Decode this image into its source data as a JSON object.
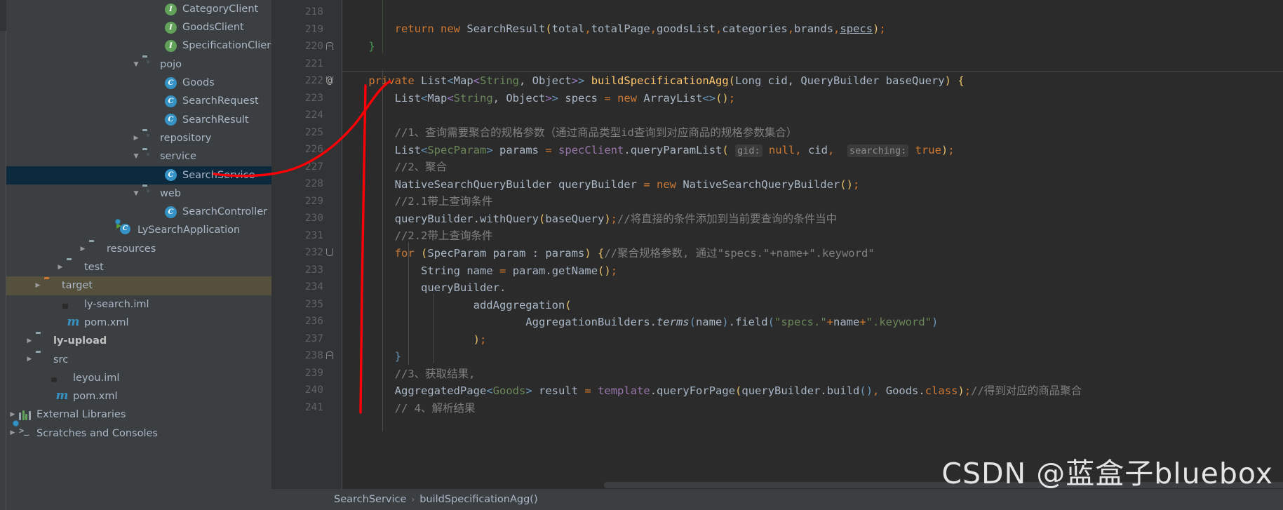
{
  "sidebar": {
    "items": [
      {
        "indent": 208,
        "arrow": "none",
        "icon": "interface-icon",
        "label": "CategoryClient",
        "bold": false,
        "state": "normal"
      },
      {
        "indent": 208,
        "arrow": "none",
        "icon": "interface-icon",
        "label": "GoodsClient",
        "bold": false,
        "state": "normal"
      },
      {
        "indent": 208,
        "arrow": "none",
        "icon": "interface-icon",
        "label": "SpecificationClier",
        "bold": false,
        "state": "normal"
      },
      {
        "indent": 176,
        "arrow": "down",
        "icon": "folder-icon",
        "label": "pojo",
        "bold": false,
        "state": "normal"
      },
      {
        "indent": 208,
        "arrow": "none",
        "icon": "class-icon",
        "label": "Goods",
        "bold": false,
        "state": "normal"
      },
      {
        "indent": 208,
        "arrow": "none",
        "icon": "class-icon",
        "label": "SearchRequest",
        "bold": false,
        "state": "normal"
      },
      {
        "indent": 208,
        "arrow": "none",
        "icon": "class-icon",
        "label": "SearchResult",
        "bold": false,
        "state": "normal"
      },
      {
        "indent": 176,
        "arrow": "right",
        "icon": "folder-icon",
        "label": "repository",
        "bold": false,
        "state": "normal"
      },
      {
        "indent": 176,
        "arrow": "down",
        "icon": "folder-icon",
        "label": "service",
        "bold": false,
        "state": "normal"
      },
      {
        "indent": 208,
        "arrow": "none",
        "icon": "class-icon",
        "label": "SearchService",
        "bold": false,
        "state": "selected"
      },
      {
        "indent": 176,
        "arrow": "down",
        "icon": "folder-icon",
        "label": "web",
        "bold": false,
        "state": "normal"
      },
      {
        "indent": 208,
        "arrow": "none",
        "icon": "class-icon",
        "label": "SearchController",
        "bold": false,
        "state": "normal"
      },
      {
        "indent": 144,
        "arrow": "none",
        "icon": "spring-app-icon",
        "label": "LySearchApplication",
        "bold": false,
        "state": "normal"
      },
      {
        "indent": 100,
        "arrow": "right",
        "icon": "resources-folder-icon",
        "label": "resources",
        "bold": false,
        "state": "normal"
      },
      {
        "indent": 68,
        "arrow": "right",
        "icon": "folder-plain-icon",
        "label": "test",
        "bold": false,
        "state": "normal"
      },
      {
        "indent": 36,
        "arrow": "right",
        "icon": "folder-orange-icon",
        "label": "target",
        "bold": false,
        "state": "target-highlight"
      },
      {
        "indent": 68,
        "arrow": "none",
        "icon": "iml-file-icon",
        "label": "ly-search.iml",
        "bold": false,
        "state": "normal"
      },
      {
        "indent": 68,
        "arrow": "none",
        "icon": "maven-icon",
        "label": "pom.xml",
        "bold": false,
        "state": "normal"
      },
      {
        "indent": 24,
        "arrow": "right",
        "icon": "module-folder-icon",
        "label": "ly-upload",
        "bold": true,
        "state": "normal"
      },
      {
        "indent": 24,
        "arrow": "right",
        "icon": "folder-plain-icon",
        "label": "src",
        "bold": false,
        "state": "normal"
      },
      {
        "indent": 52,
        "arrow": "none",
        "icon": "iml-file-icon",
        "label": "leyou.iml",
        "bold": false,
        "state": "normal"
      },
      {
        "indent": 52,
        "arrow": "none",
        "icon": "maven-icon",
        "label": "pom.xml",
        "bold": false,
        "state": "normal"
      },
      {
        "indent": 0,
        "arrow": "right",
        "icon": "external-libraries-icon",
        "label": "External Libraries",
        "bold": false,
        "state": "normal"
      },
      {
        "indent": 0,
        "arrow": "right",
        "icon": "scratches-icon",
        "label": "Scratches and Consoles",
        "bold": false,
        "state": "normal"
      }
    ]
  },
  "editor": {
    "first_visible_line": 218,
    "gutter_at_symbol": "@",
    "lines": [
      {
        "n": 218,
        "fold": "none"
      },
      {
        "n": 219,
        "fold": "none"
      },
      {
        "n": 220,
        "fold": "close"
      },
      {
        "n": 221,
        "fold": "none"
      },
      {
        "n": 222,
        "fold": "open",
        "at": true
      },
      {
        "n": 223,
        "fold": "none"
      },
      {
        "n": 224,
        "fold": "none"
      },
      {
        "n": 225,
        "fold": "none"
      },
      {
        "n": 226,
        "fold": "none"
      },
      {
        "n": 227,
        "fold": "none"
      },
      {
        "n": 228,
        "fold": "none"
      },
      {
        "n": 229,
        "fold": "none"
      },
      {
        "n": 230,
        "fold": "none"
      },
      {
        "n": 231,
        "fold": "none"
      },
      {
        "n": 232,
        "fold": "open"
      },
      {
        "n": 233,
        "fold": "none"
      },
      {
        "n": 234,
        "fold": "none"
      },
      {
        "n": 235,
        "fold": "none"
      },
      {
        "n": 236,
        "fold": "none"
      },
      {
        "n": 237,
        "fold": "none"
      },
      {
        "n": 238,
        "fold": "close"
      },
      {
        "n": 239,
        "fold": "none"
      },
      {
        "n": 240,
        "fold": "none"
      },
      {
        "n": 241,
        "fold": "none"
      }
    ],
    "code_text": {
      "l219": "        return new SearchResult(total,totalPage,goodsList,categories,brands,specs);",
      "l220": "    }",
      "l222": "    private List<Map<String, Object>> buildSpecificationAgg(Long cid, QueryBuilder baseQuery) {",
      "l223": "        List<Map<String, Object>> specs = new ArrayList<>();",
      "l225": "        //1、查询需要聚合的规格参数（通过商品类型id查询到对应商品的规格参数集合）",
      "l226": "        List<SpecParam> params = specClient.queryParamList( gid: null, cid,  searching: true);",
      "l227": "        //2、聚合",
      "l228": "        NativeSearchQueryBuilder queryBuilder = new NativeSearchQueryBuilder();",
      "l229": "        //2.1带上查询条件",
      "l230": "        queryBuilder.withQuery(baseQuery);//将直接的条件添加到当前要查询的条件当中",
      "l231": "        //2.2带上查询条件",
      "l232": "        for (SpecParam param : params) {//聚合规格参数, 通过\"specs.\"+name+\".keyword\"",
      "l233": "            String name = param.getName();",
      "l234": "            queryBuilder.",
      "l235": "                    addAggregation(",
      "l236": "                            AggregationBuilders.terms(name).field(\"specs.\"+name+\".keyword\")",
      "l237": "                    );",
      "l238": "        }",
      "l239": "        //3、获取结果,",
      "l240": "        AggregatedPage<Goods> result = template.queryForPage(queryBuilder.build(), Goods.class);//得到对应的商品聚合",
      "l241": "        // 4、解析结果"
    },
    "tokens": {
      "kw_return": "return",
      "kw_new": "new",
      "kw_private": "private",
      "kw_for": "for",
      "type_SearchResult": "SearchResult",
      "type_List": "List",
      "type_Map": "Map",
      "type_String": "String",
      "type_Object": "Object",
      "type_Long": "Long",
      "type_QueryBuilder": "QueryBuilder",
      "type_ArrayList": "ArrayList",
      "type_SpecParam": "SpecParam",
      "type_NativeSearchQueryBuilder": "NativeSearchQueryBuilder",
      "type_AggregationBuilders": "AggregationBuilders",
      "type_AggregatedPage": "AggregatedPage",
      "type_Goods": "Goods",
      "method_buildSpecificationAgg": "buildSpecificationAgg",
      "hint_gid": "gid:",
      "hint_searching": "searching:",
      "literal_null": "null",
      "literal_true": "true"
    }
  },
  "breadcrumb": {
    "class": "SearchService",
    "separator": "›",
    "method": "buildSpecificationAgg()"
  },
  "watermark": {
    "text": "CSDN @蓝盒子bluebox"
  },
  "colors": {
    "editor_background": "#2b2b2b",
    "gutter_background": "#313335",
    "sidebar_background": "#3c3f41",
    "selection_blue": "#0d293e",
    "target_highlight": "#55503c",
    "keyword_orange": "#cc7832",
    "string_green": "#6a8759",
    "number_blue": "#6897bb",
    "comment_gray": "#808080",
    "method_yellow": "#ffc66d",
    "field_purple": "#9876aa",
    "default_text": "#a9b7c6",
    "annotation_red": "#fb0007"
  },
  "annotation": {
    "type": "hand-drawn-red-marker",
    "shapes": [
      "curve-from-SearchService-node-to-line-222",
      "long-vertical-line-down-left-code-margin"
    ]
  }
}
